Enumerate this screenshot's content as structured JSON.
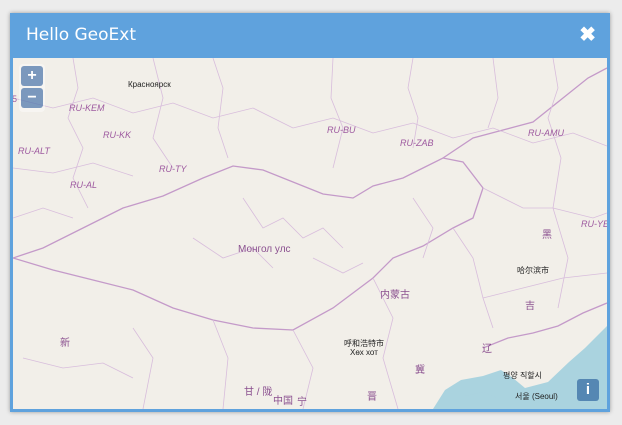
{
  "window": {
    "title": "Hello GeoExt",
    "close_glyph": "✖"
  },
  "zoom": {
    "in_label": "+",
    "out_label": "−"
  },
  "info": {
    "label": "i"
  },
  "map": {
    "edge_left": "5",
    "regions": {
      "ru_kem": "RU-KEM",
      "ru_kk": "RU-KK",
      "ru_alt": "RU-ALT",
      "ru_al": "RU-AL",
      "ru_ty": "RU-TY",
      "ru_bu": "RU-BU",
      "ru_zab": "RU-ZAB",
      "ru_amu": "RU-AMU",
      "ru_ye": "RU-YE"
    },
    "cities": {
      "krasnoyarsk": "Красноярск",
      "harbin": "哈尔滨市",
      "hohhot": "呼和浩特市",
      "hohhot_mn": "Хөх хот",
      "seoul": "서울 (Seoul)",
      "pyongyang": "평양 직할시"
    },
    "countries": {
      "mongolia": "Монгол улс",
      "inner_mongolia": "内蒙古",
      "china": "中国",
      "xin": "新",
      "hei": "黑",
      "ji": "吉",
      "liao": "辽",
      "ji2": "冀",
      "jin": "晋",
      "gansu": "甘 / 陇",
      "ning": "宁"
    },
    "colors": {
      "land": "#f2efe9",
      "water": "#aad3df",
      "border": "#cba6d1"
    }
  }
}
